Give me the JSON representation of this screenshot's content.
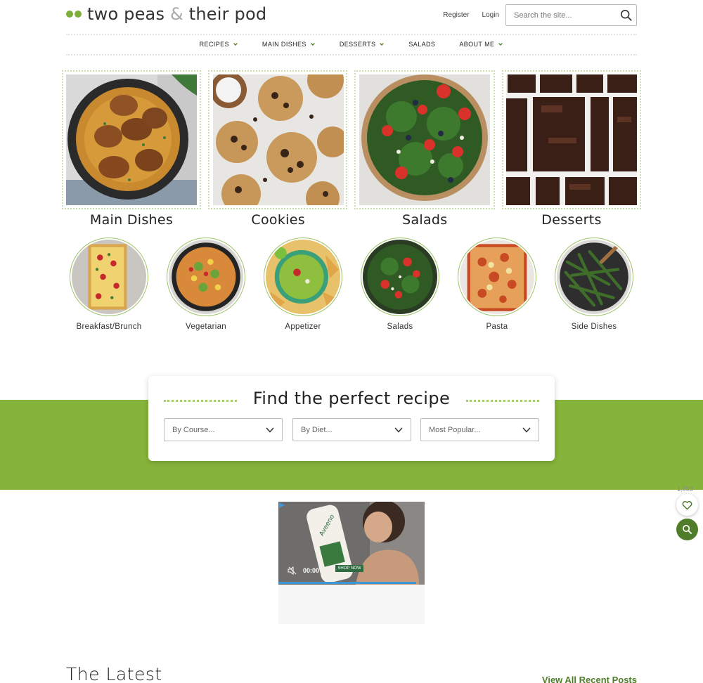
{
  "brand": {
    "name_part1": "two peas",
    "amp": "&",
    "name_part2": "their pod",
    "accent": "#86b43a",
    "dark_green": "#4f7d2a"
  },
  "header": {
    "register": "Register",
    "login": "Login",
    "search_placeholder": "Search the site..."
  },
  "nav": [
    {
      "label": "RECIPES",
      "dropdown": true
    },
    {
      "label": "MAIN DISHES",
      "dropdown": true
    },
    {
      "label": "DESSERTS",
      "dropdown": true
    },
    {
      "label": "SALADS",
      "dropdown": false
    },
    {
      "label": "ABOUT ME",
      "dropdown": true
    }
  ],
  "categories": [
    {
      "label": "Main Dishes",
      "image": "skillet-chicken"
    },
    {
      "label": "Cookies",
      "image": "chocolate-chip-cookies"
    },
    {
      "label": "Salads",
      "image": "kale-strawberry-salad"
    },
    {
      "label": "Desserts",
      "image": "brownies"
    }
  ],
  "subcategories": [
    {
      "label": "Breakfast/Brunch",
      "image": "tart"
    },
    {
      "label": "Vegetarian",
      "image": "skillet"
    },
    {
      "label": "Appetizer",
      "image": "guacamole"
    },
    {
      "label": "Salads",
      "image": "salad"
    },
    {
      "label": "Pasta",
      "image": "lasagna"
    },
    {
      "label": "Side Dishes",
      "image": "green-beans"
    }
  ],
  "finder": {
    "title": "Find the perfect recipe",
    "selects": [
      "By Course...",
      "By Diet...",
      "Most Popular..."
    ]
  },
  "floating": {
    "favorites_count": "1,093"
  },
  "ad": {
    "time": "00:00",
    "cta": "SHOP NOW",
    "product": "Aveeno"
  },
  "latest": {
    "title": "The Latest",
    "view_all": "View All Recent Posts"
  }
}
